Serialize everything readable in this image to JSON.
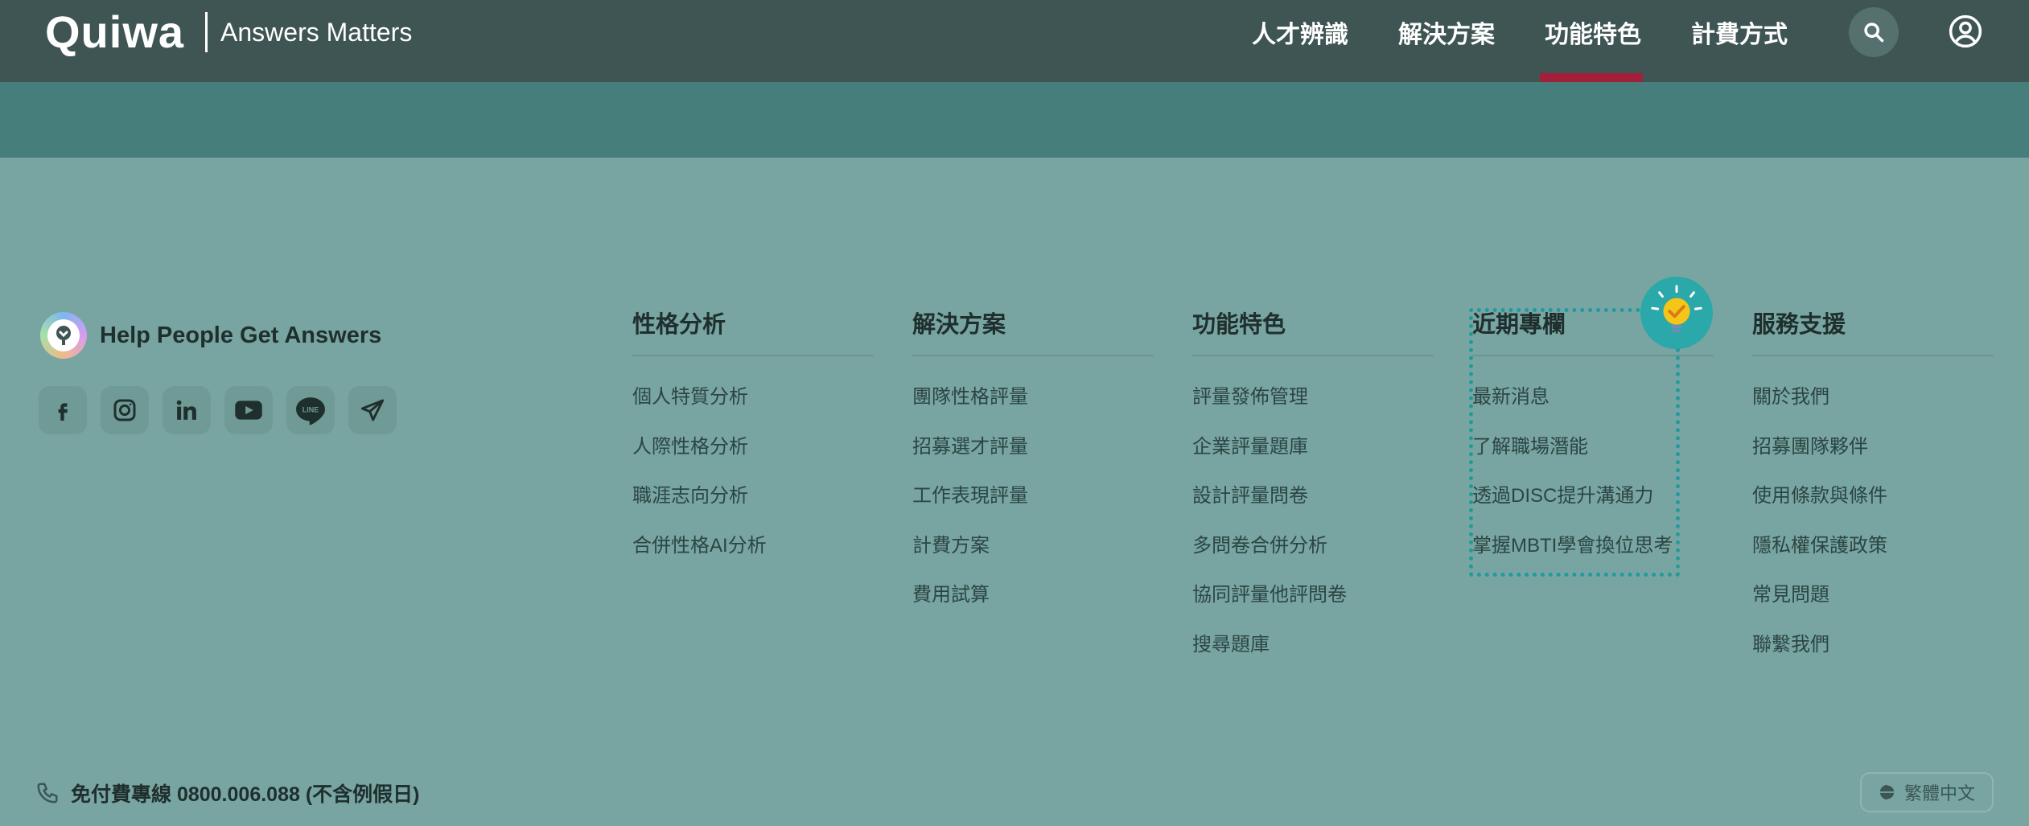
{
  "header": {
    "logo": "Quiwa",
    "tagline": "Answers Matters",
    "nav": [
      {
        "label": "人才辨識"
      },
      {
        "label": "解決方案"
      },
      {
        "label": "功能特色",
        "active": true
      },
      {
        "label": "計費方式"
      }
    ],
    "search_icon": "search-icon",
    "user_icon": "user-circle-icon"
  },
  "footer": {
    "brand_text": "Help People Get Answers",
    "socials": [
      "facebook-icon",
      "instagram-icon",
      "linkedin-icon",
      "youtube-icon",
      "line-icon",
      "telegram-icon"
    ],
    "columns": [
      {
        "title": "性格分析",
        "items": [
          "個人特質分析",
          "人際性格分析",
          "職涯志向分析",
          "合併性格AI分析"
        ]
      },
      {
        "title": "解決方案",
        "items": [
          "團隊性格評量",
          "招募選才評量",
          "工作表現評量",
          "計費方案",
          "費用試算"
        ]
      },
      {
        "title": "功能特色",
        "items": [
          "評量發佈管理",
          "企業評量題庫",
          "設計評量問卷",
          "多問卷合併分析",
          "協同評量他評問卷",
          "搜尋題庫"
        ]
      },
      {
        "title": "近期專欄",
        "items": [
          "最新消息",
          "了解職場潛能",
          "透過DISC提升溝通力",
          "掌握MBTI學會換位思考"
        ]
      },
      {
        "title": "服務支援",
        "items": [
          "關於我們",
          "招募團隊夥伴",
          "使用條款與條件",
          "隱私權保護政策",
          "常見問題",
          "聯繫我們"
        ]
      }
    ],
    "phone_text": "免付費專線 0800.006.088 (不含例假日)",
    "language": "繁體中文"
  },
  "colors": {
    "header_bg": "#3e5553",
    "band_bg": "#457e7a",
    "footer_bg": "#78a5a1",
    "nav_active": "#a3203a",
    "highlight_border": "#1f9b9e",
    "bulb": "#f5c518"
  }
}
